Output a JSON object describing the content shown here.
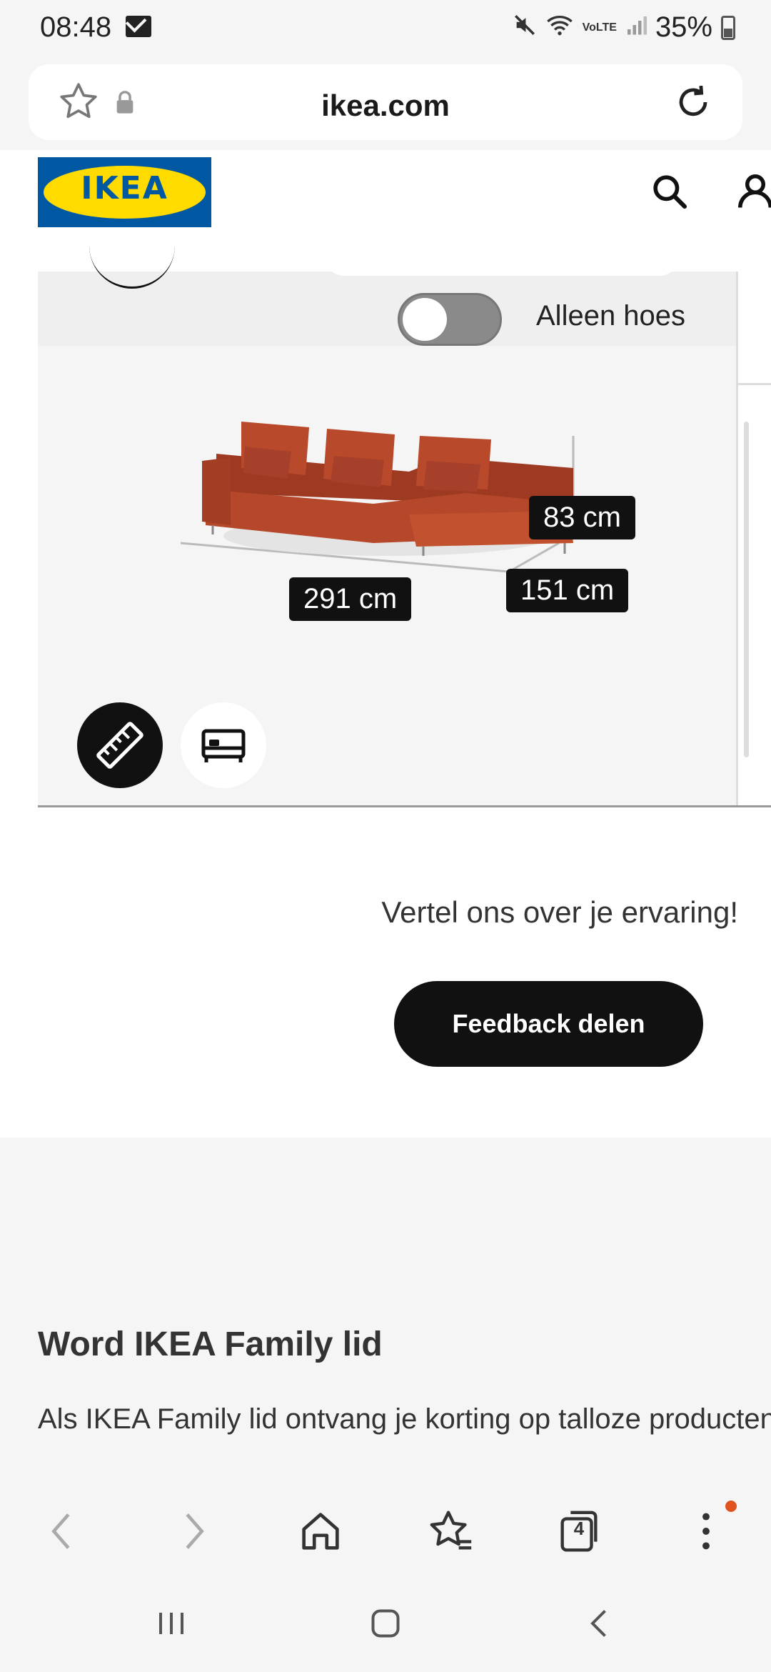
{
  "status_bar": {
    "time": "08:48",
    "battery": "35%",
    "network_label": "VoLTE"
  },
  "browser": {
    "url": "ikea.com",
    "tabs_count": "4",
    "icons": [
      "star-icon",
      "lock-icon",
      "reload-icon",
      "back-icon",
      "forward-icon",
      "home-icon",
      "bookmarks-icon",
      "tabs-icon",
      "more-icon"
    ]
  },
  "site_header": {
    "logo_text": "IKEA"
  },
  "viewer": {
    "toggle_label": "Alleen hoes",
    "toggle_on": false,
    "dimensions": {
      "height": "83 cm",
      "depth": "151 cm",
      "width": "291 cm"
    },
    "colors": {
      "sofa": "#b5482a"
    }
  },
  "feedback": {
    "prompt": "Vertel ons over je ervaring!",
    "button_label": "Feedback delen"
  },
  "family": {
    "title": "Word IKEA Family lid",
    "text": "Als IKEA Family lid ontvang je korting op talloze producten"
  }
}
